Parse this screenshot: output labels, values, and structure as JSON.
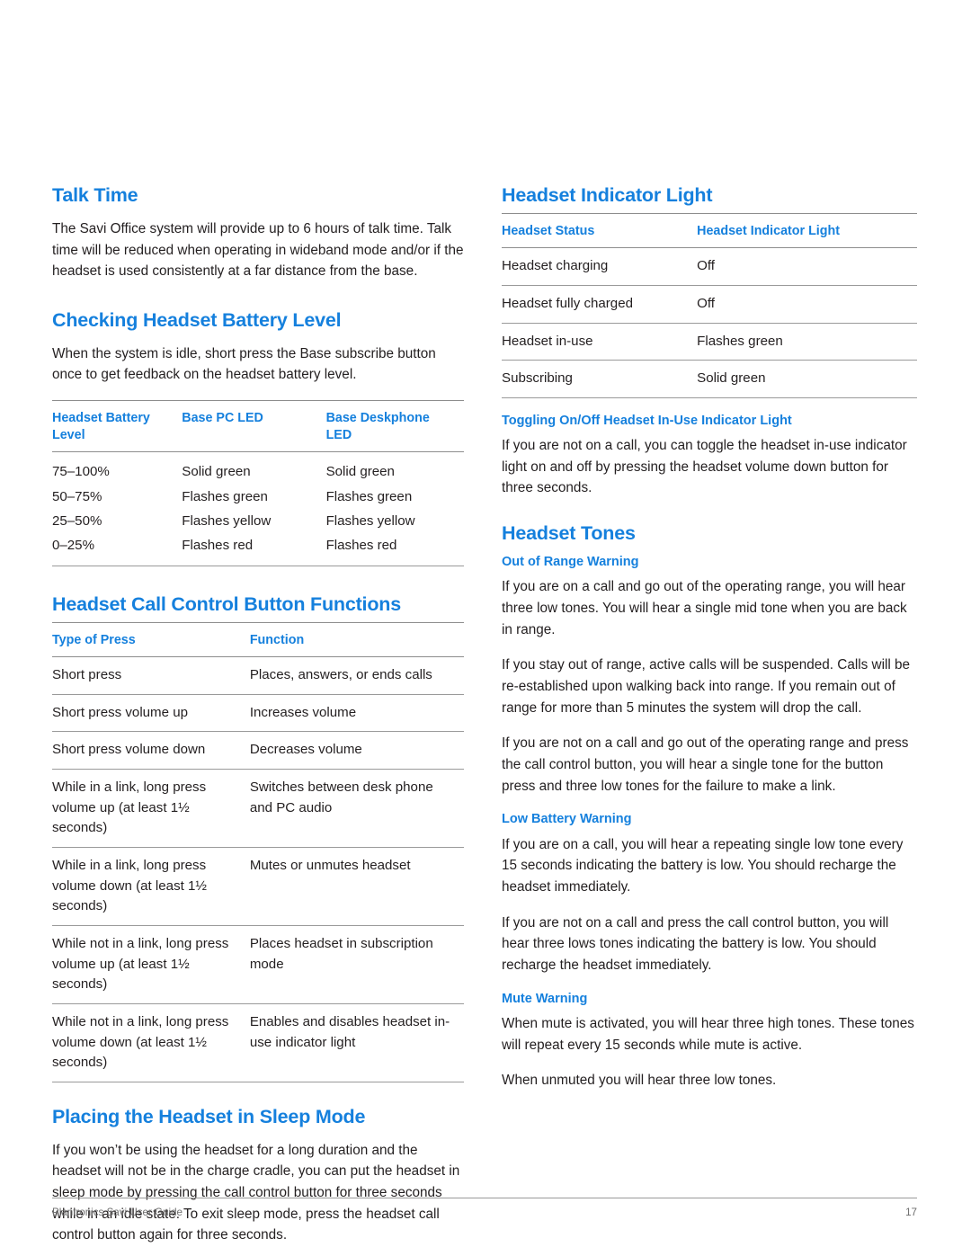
{
  "document": {
    "footer_text": "Plantronics Savi User Guide",
    "page_number": "17",
    "accent_color": "#1580dd",
    "rule_color": "#8d8d8d"
  },
  "left_column": {
    "talk_time": {
      "heading": "Talk Time",
      "paragraph": "The Savi Office system will provide up to 6 hours of talk time. Talk time will be reduced when operating in wideband mode and/or if the headset is used consistently at a far distance from the base."
    },
    "battery_level": {
      "heading": "Checking Headset Battery Level",
      "paragraph": "When the system is idle, short press the Base subscribe button once to get feedback on the headset battery level.",
      "table": {
        "headers": [
          "Headset Battery Level",
          "Base PC LED",
          "Base Deskphone LED"
        ],
        "rows": [
          [
            "75–100%",
            "Solid green",
            "Solid green"
          ],
          [
            "50–75%",
            "Flashes green",
            "Flashes green"
          ],
          [
            "25–50%",
            "Flashes yellow",
            "Flashes yellow"
          ],
          [
            "0–25%",
            "Flashes red",
            "Flashes red"
          ]
        ]
      }
    },
    "call_control": {
      "heading": "Headset Call Control Button Functions",
      "table": {
        "headers": [
          "Type of Press",
          "Function"
        ],
        "rows": [
          [
            "Short press",
            "Places, answers, or ends calls"
          ],
          [
            "Short press volume up",
            "Increases volume"
          ],
          [
            "Short press volume down",
            "Decreases volume"
          ],
          [
            "While in a link, long press volume up (at least 1½ seconds)",
            "Switches between desk phone and PC audio"
          ],
          [
            "While in a link, long press volume down (at least 1½ seconds)",
            "Mutes or unmutes headset"
          ],
          [
            "While not in a link, long press volume up (at least 1½ seconds)",
            "Places headset in subscription mode"
          ],
          [
            "While not in a link, long press volume down (at least 1½ seconds)",
            "Enables and disables headset in-use indicator light"
          ]
        ]
      }
    },
    "sleep_mode": {
      "heading": "Placing the Headset in Sleep Mode",
      "paragraph": "If you won’t be using the headset for a long duration and the headset will not be in the charge cradle, you can put the headset in sleep mode by pressing the call control button for three seconds while in an idle state. To exit sleep mode, press the headset call control button again for three seconds."
    }
  },
  "right_column": {
    "indicator_light": {
      "heading": "Headset Indicator Light",
      "table": {
        "headers": [
          "Headset Status",
          "Headset Indicator Light"
        ],
        "rows": [
          [
            "Headset charging",
            "Off"
          ],
          [
            "Headset fully charged",
            "Off"
          ],
          [
            "Headset in-use",
            "Flashes green"
          ],
          [
            "Subscribing",
            "Solid green"
          ]
        ]
      }
    },
    "toggling": {
      "heading": "Toggling On/Off Headset In-Use Indicator Light",
      "paragraph": "If you are not on a call, you can toggle the headset in-use indicator light on and off by pressing the headset volume down button for three seconds."
    },
    "headset_tones": {
      "heading": "Headset Tones",
      "out_of_range": {
        "heading": "Out of Range Warning",
        "paragraphs": [
          "If you are on a call and go out of the operating range, you will hear three low tones. You will hear a single mid tone when you are back in range.",
          "If you stay out of range, active calls will be suspended. Calls will be re-established upon walking back into range. If you remain out of range for more than 5 minutes the system will drop the call.",
          "If you are not on a call and go out of the operating range and press the call control button, you will hear a single tone for the button press and three low tones for the failure to make a link."
        ]
      },
      "low_battery": {
        "heading": "Low Battery Warning",
        "paragraphs": [
          "If you are on a call, you will hear a repeating single low tone every 15 seconds indicating the battery is low. You should recharge the headset immediately.",
          "If you are not on a call and press the call control button, you will hear three lows tones indicating the battery is low. You should recharge the headset immediately."
        ]
      },
      "mute": {
        "heading": "Mute Warning",
        "paragraphs": [
          "When mute is activated, you will hear three high tones. These tones will repeat every 15 seconds while mute is active.",
          "When unmuted you will hear three low tones."
        ]
      }
    }
  }
}
